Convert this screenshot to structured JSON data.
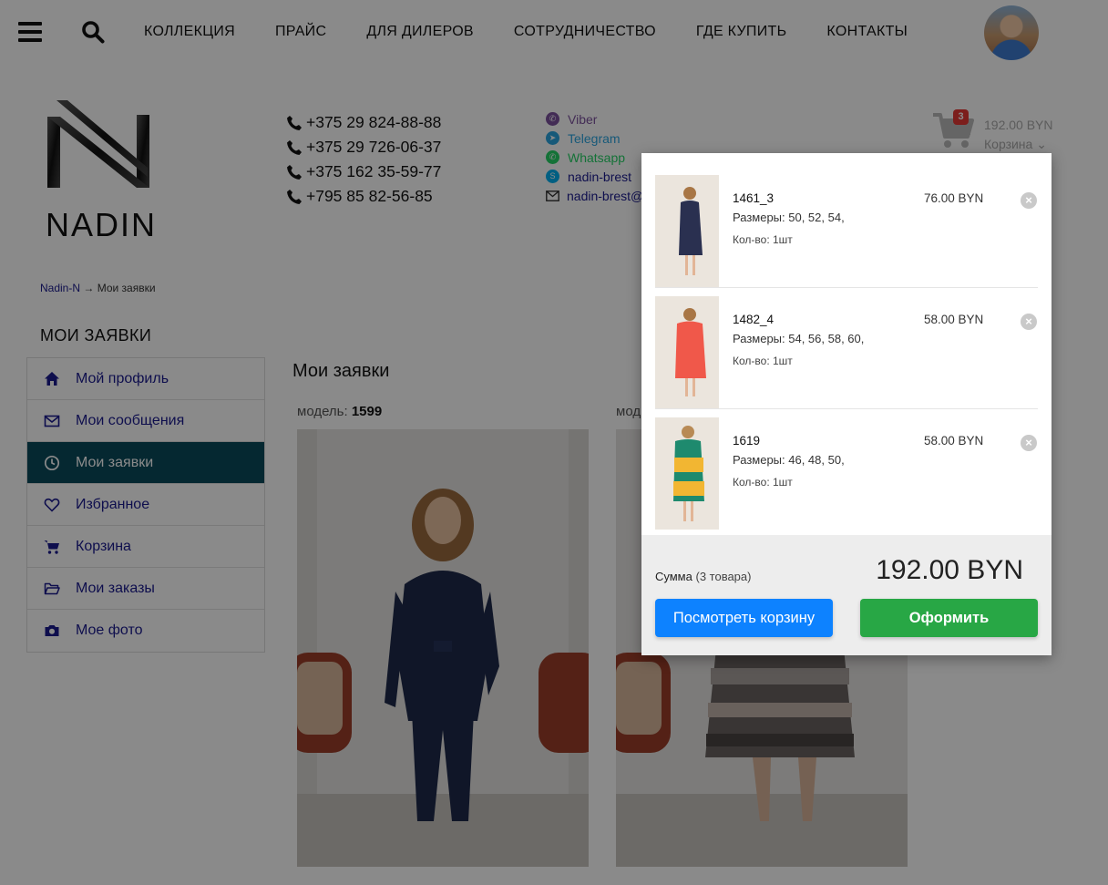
{
  "nav": {
    "links": [
      "КОЛЛЕКЦИЯ",
      "ПРАЙС",
      "ДЛЯ ДИЛЕРОВ",
      "СОТРУДНИЧЕСТВО",
      "ГДЕ КУПИТЬ",
      "КОНТАКТЫ"
    ]
  },
  "brand": {
    "logo_text": "NADIN"
  },
  "contacts": {
    "phones": [
      "+375 29 824-88-88",
      "+375 29 726-06-37",
      "+375 162 35-59-77",
      "+795 85 82-56-85"
    ],
    "socials": [
      {
        "label": "Viber",
        "color": "#7c529e",
        "icon": "viber-icon"
      },
      {
        "label": "Telegram",
        "color": "#2ca5e0",
        "icon": "telegram-icon"
      },
      {
        "label": "Whatsapp",
        "color": "#25d366",
        "icon": "whatsapp-icon"
      },
      {
        "label": "nadin-brest",
        "color": "#00aff0",
        "icon": "skype-icon"
      },
      {
        "label": "nadin-brest@",
        "color": "#333333",
        "icon": "mail-icon"
      }
    ]
  },
  "cart": {
    "count": "3",
    "total": "192.00 BYN",
    "label": "Корзина"
  },
  "breadcrumb": {
    "home": "Nadin-N",
    "separator": "→",
    "current": "Мои заявки"
  },
  "sidebar": {
    "title": "МОИ ЗАЯВКИ",
    "items": [
      {
        "label": "Мой профиль",
        "icon": "home-icon"
      },
      {
        "label": "Мои сообщения",
        "icon": "envelope-icon"
      },
      {
        "label": "Мои заявки",
        "icon": "clock-icon",
        "active": true
      },
      {
        "label": "Избранное",
        "icon": "heart-icon"
      },
      {
        "label": "Корзина",
        "icon": "cart-icon"
      },
      {
        "label": "Мои заказы",
        "icon": "folder-icon"
      },
      {
        "label": "Мое фото",
        "icon": "camera-icon"
      }
    ]
  },
  "main": {
    "title": "Мои заявки",
    "models": [
      {
        "prefix": "модель:",
        "number": "1599"
      },
      {
        "prefix": "мод",
        "number": ""
      }
    ]
  },
  "cart_dropdown": {
    "items": [
      {
        "code": "1461_3",
        "sizes": "Размеры: 50, 52, 54,",
        "qty": "Кол-во: 1шт",
        "price": "76.00 BYN",
        "dress_color": "#2a3050"
      },
      {
        "code": "1482_4",
        "sizes": "Размеры: 54, 56, 58, 60,",
        "qty": "Кол-во: 1шт",
        "price": "58.00 BYN",
        "dress_color": "#f0584a"
      },
      {
        "code": "1619",
        "sizes": "Размеры: 46, 48, 50,",
        "qty": "Кол-во: 1шт",
        "price": "58.00 BYN",
        "dress_color": "#f2b632"
      }
    ],
    "sum_label": "Сумма",
    "sum_count": "(3 товара)",
    "sum_value": "192.00 BYN",
    "view_cart": "Посмотреть корзину",
    "checkout": "Оформить"
  }
}
